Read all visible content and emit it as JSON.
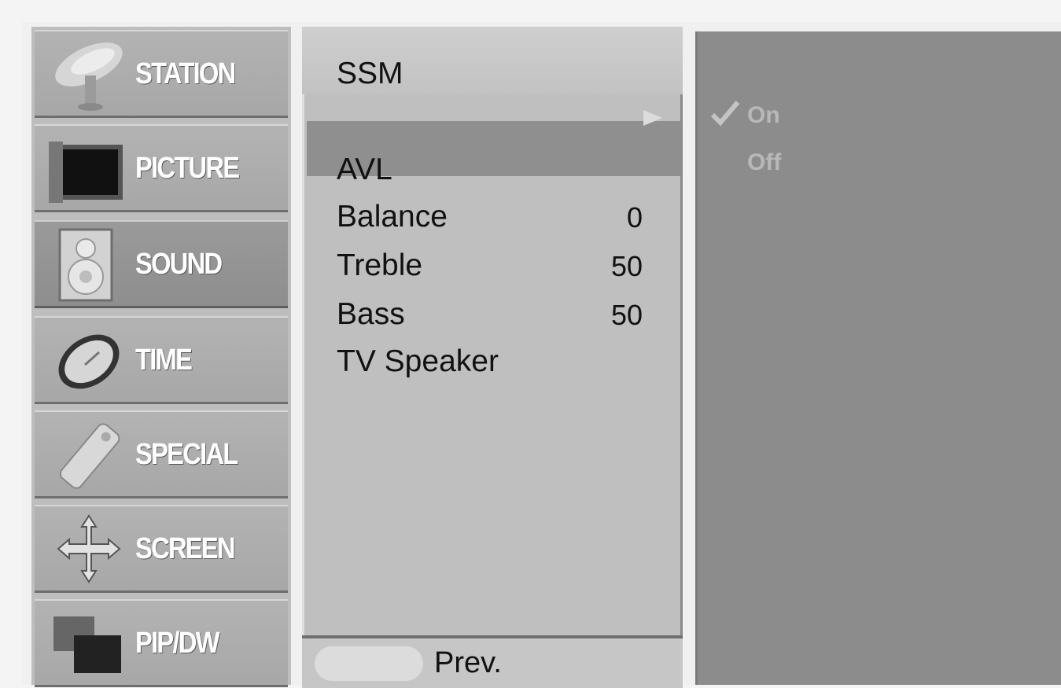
{
  "sidebar": {
    "items": [
      {
        "label": "STATION",
        "icon": "satellite-dish-icon"
      },
      {
        "label": "PICTURE",
        "icon": "picture-icon"
      },
      {
        "label": "SOUND",
        "icon": "speaker-icon",
        "selected": true
      },
      {
        "label": "TIME",
        "icon": "clock-icon"
      },
      {
        "label": "SPECIAL",
        "icon": "remote-tag-icon"
      },
      {
        "label": "SCREEN",
        "icon": "move-arrows-icon"
      },
      {
        "label": "PIP/DW",
        "icon": "pip-windows-icon"
      }
    ]
  },
  "submenu": {
    "items": [
      {
        "label": "SSM",
        "value": ""
      },
      {
        "label": "",
        "value": "",
        "highlighted": true
      },
      {
        "label": "AVL",
        "value": ""
      },
      {
        "label": "Balance",
        "value": "0"
      },
      {
        "label": "Treble",
        "value": "50"
      },
      {
        "label": "Bass",
        "value": "50"
      },
      {
        "label": "TV Speaker",
        "value": ""
      }
    ],
    "footer": {
      "menu_button": "",
      "prev_label": "Prev."
    }
  },
  "options": {
    "items": [
      {
        "label": "On",
        "checked": true
      },
      {
        "label": "Off",
        "checked": false
      }
    ]
  },
  "colors": {
    "sidebar_bg": "#a7a7a7",
    "selected_bg": "#8e8e8e",
    "submenu_bg": "#bfbfbf",
    "options_bg": "#8c8c8c"
  }
}
